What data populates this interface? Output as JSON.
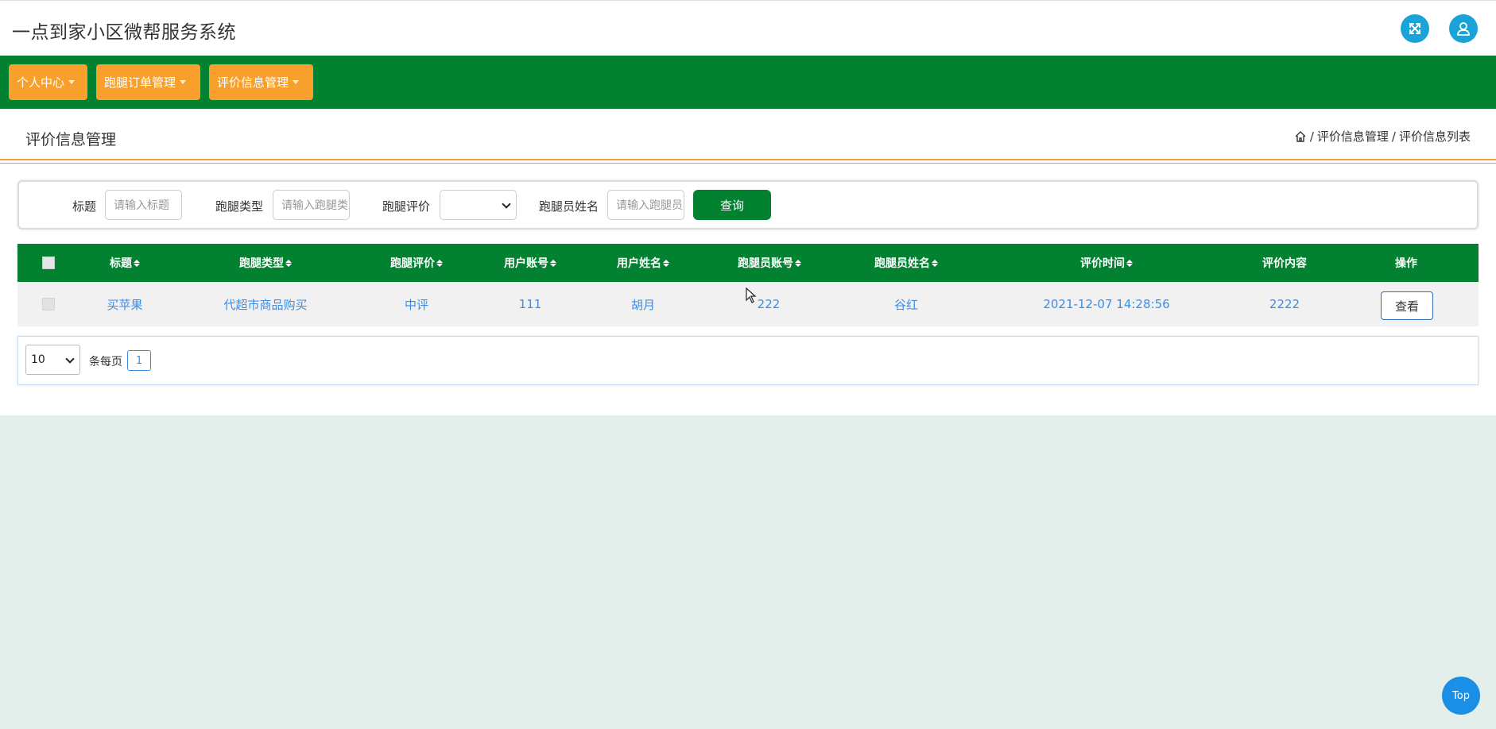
{
  "header": {
    "app_title": "一点到家小区微帮服务系统",
    "fullscreen_icon": "expand-icon",
    "user_icon": "user-icon"
  },
  "nav": {
    "items": [
      {
        "label": "个人中心"
      },
      {
        "label": "跑腿订单管理"
      },
      {
        "label": "评价信息管理"
      }
    ]
  },
  "page": {
    "title": "评价信息管理",
    "breadcrumb": {
      "home_icon": "home-icon",
      "sep": "/",
      "level1": "评价信息管理",
      "level2": "评价信息列表"
    }
  },
  "search": {
    "title_label": "标题",
    "title_placeholder": "请输入标题",
    "type_label": "跑腿类型",
    "type_placeholder": "请输入跑腿类型",
    "rating_label": "跑腿评价",
    "rating_value": "",
    "runner_label": "跑腿员姓名",
    "runner_placeholder": "请输入跑腿员姓名",
    "query_label": "查询"
  },
  "table": {
    "columns": [
      "标题",
      "跑腿类型",
      "跑腿评价",
      "用户账号",
      "用户姓名",
      "跑腿员账号",
      "跑腿员姓名",
      "评价时间",
      "评价内容",
      "操作"
    ],
    "rows": [
      {
        "title": "买苹果",
        "type": "代超市商品购买",
        "rating": "中评",
        "user_account": "111",
        "user_name": "胡月",
        "runner_account": "222",
        "runner_name": "谷红",
        "time": "2021-12-07 14:28:56",
        "content": "2222",
        "action": "查看"
      }
    ]
  },
  "pagination": {
    "page_size": "10",
    "per_page_label": "条每页",
    "current_page": "1"
  },
  "top_button": "Top",
  "colors": {
    "primary_green": "#028230",
    "nav_orange": "#f7a02b",
    "accent_blue": "#1aa3d8",
    "link_blue": "#3a8ee6",
    "divider_orange": "#e8a33c"
  }
}
